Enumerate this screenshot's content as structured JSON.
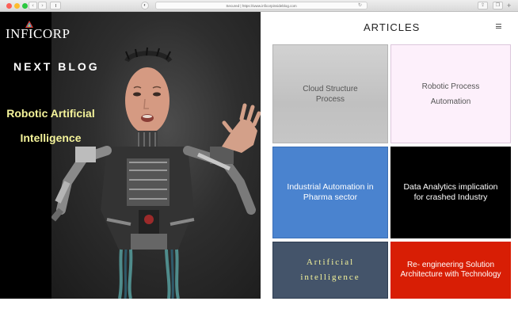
{
  "browser": {
    "url_text": "Secured | https://www.inficorpinsideblog.com",
    "shield_icon": "shield-icon",
    "reload_icon": "reload-icon"
  },
  "hero": {
    "logo": "INFICORP",
    "next_blog_label": "NEXT BLOG",
    "title_line1": "Robotic Artificial",
    "title_line2": "Intelligence"
  },
  "articles": {
    "heading": "ARTICLES",
    "menu_icon": "hamburger-menu-icon",
    "cards": [
      {
        "line1": "Cloud Structure",
        "line2": "Process",
        "bg": "#c6c6c6"
      },
      {
        "line1": "Robotic Process",
        "line2": "Automation",
        "bg": "#fdf0fb"
      },
      {
        "line1": "Industrial Automation in",
        "line2": "Pharma sector",
        "bg": "#4a83cf"
      },
      {
        "line1": "Data Analytics implication",
        "line2": "for crashed Industry",
        "bg": "#000000"
      },
      {
        "line1": "Artificial",
        "line2": "intelligence",
        "bg": "#44546a"
      },
      {
        "line1": "Re- engineering Solution",
        "line2": "Architecture with Technology",
        "bg": "#d81e05"
      }
    ]
  },
  "colors": {
    "hero_title": "#f4f39a",
    "accent_blue": "#4a83cf",
    "accent_red": "#d81e05",
    "slate": "#44546a"
  }
}
